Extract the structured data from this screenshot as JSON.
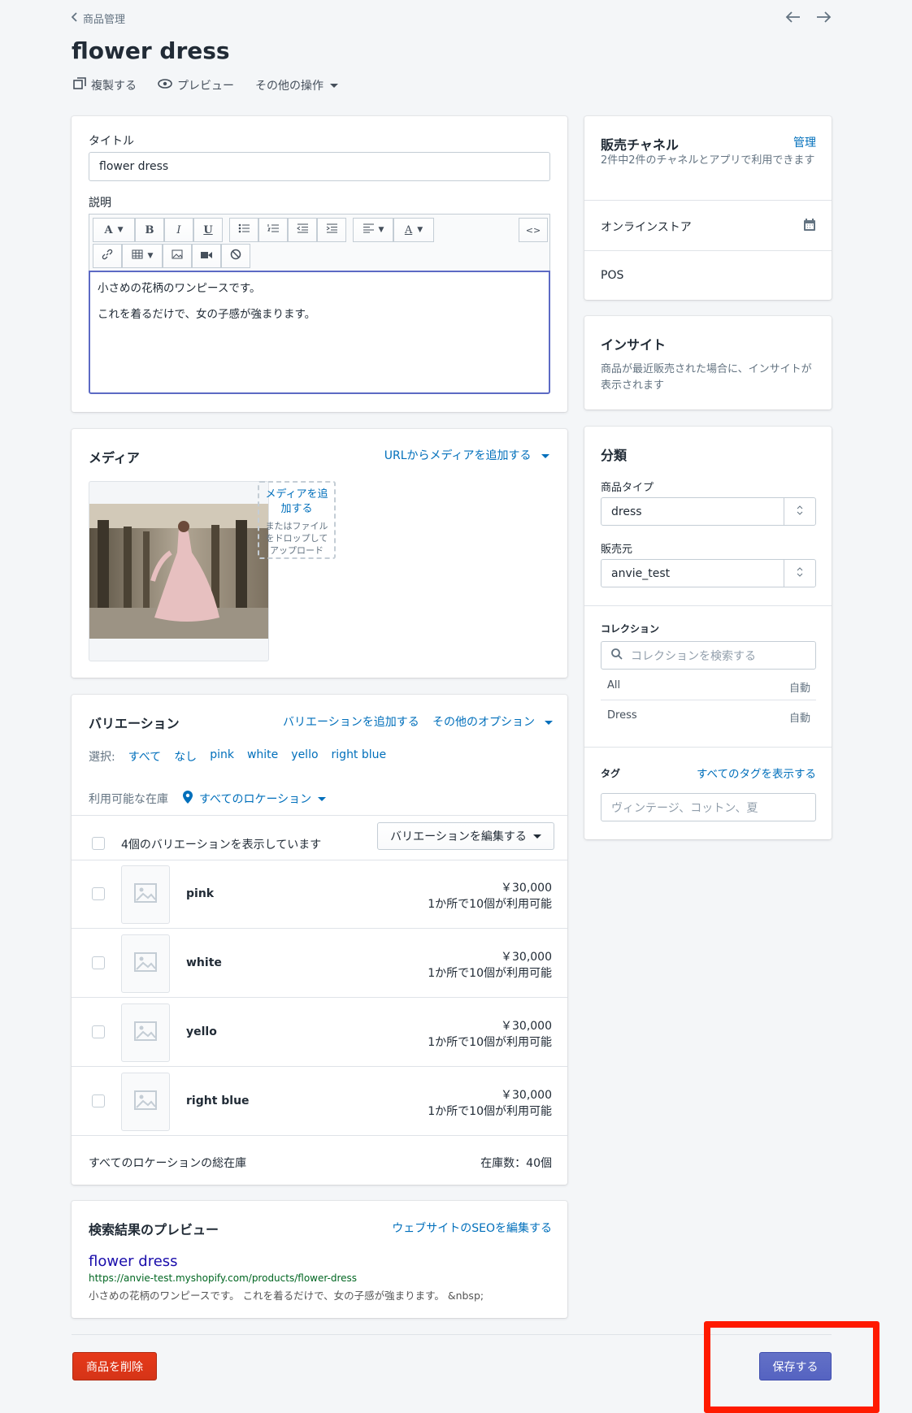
{
  "header": {
    "breadcrumb": "商品管理",
    "title": "flower dress",
    "actions": {
      "duplicate": "複製する",
      "preview": "プレビュー",
      "more": "その他の操作"
    }
  },
  "title_card": {
    "title_label": "タイトル",
    "title_value": "flower dress",
    "description_label": "説明",
    "description_lines": [
      "小さめの花柄のワンピースです。",
      "これを着るだけで、女の子感が強まります。"
    ]
  },
  "media_card": {
    "title": "メディア",
    "add_from_url": "URLからメディアを追加する",
    "dropzone_link": "メディアを追加する",
    "dropzone_hint": "またはファイルをドロップしてアップロード"
  },
  "variants_card": {
    "title": "バリエーション",
    "add_variant": "バリエーションを追加する",
    "more_options": "その他のオプション",
    "select_label": "選択:",
    "select_options": [
      "すべて",
      "なし",
      "pink",
      "white",
      "yello",
      "right blue"
    ],
    "inventory_label": "利用可能な在庫",
    "location_link": "すべてのロケーション",
    "showing_text": "4個のバリエーションを表示しています",
    "edit_variants": "バリエーションを編集する",
    "rows": [
      {
        "name": "pink",
        "price": "￥30,000",
        "stock": "1か所で10個が利用可能"
      },
      {
        "name": "white",
        "price": "￥30,000",
        "stock": "1か所で10個が利用可能"
      },
      {
        "name": "yello",
        "price": "￥30,000",
        "stock": "1か所で10個が利用可能"
      },
      {
        "name": "right blue",
        "price": "￥30,000",
        "stock": "1か所で10個が利用可能"
      }
    ],
    "total_label": "すべてのロケーションの総在庫",
    "total_value": "在庫数：40個"
  },
  "seo_card": {
    "title": "検索結果のプレビュー",
    "edit_link": "ウェブサイトのSEOを編集する",
    "preview_title": "flower dress",
    "preview_url": "https://anvie-test.myshopify.com/products/flower-dress",
    "preview_desc": "小さめの花柄のワンピースです。 これを着るだけで、女の子感が強まります。 &nbsp;"
  },
  "channels_card": {
    "title": "販売チャネル",
    "manage": "管理",
    "subtitle": "2件中2件のチャネルとアプリで利用できます",
    "channels": [
      "オンラインストア",
      "POS"
    ]
  },
  "insights_card": {
    "title": "インサイト",
    "text": "商品が最近販売された場合に、インサイトが表示されます"
  },
  "org_card": {
    "title": "分類",
    "type_label": "商品タイプ",
    "type_value": "dress",
    "vendor_label": "販売元",
    "vendor_value": "anvie_test",
    "collections_label": "コレクション",
    "collections_placeholder": "コレクションを検索する",
    "collections": [
      {
        "name": "All",
        "mode": "自動"
      },
      {
        "name": "Dress",
        "mode": "自動"
      }
    ],
    "tags_label": "タグ",
    "tags_link": "すべてのタグを表示する",
    "tags_placeholder": "ヴィンテージ、コットン、夏"
  },
  "footer": {
    "delete": "商品を削除",
    "save": "保存する"
  },
  "colors": {
    "primary": "#5c6ac4",
    "link": "#006fbb",
    "danger": "#de3618",
    "highlight": "#ff1a00"
  }
}
